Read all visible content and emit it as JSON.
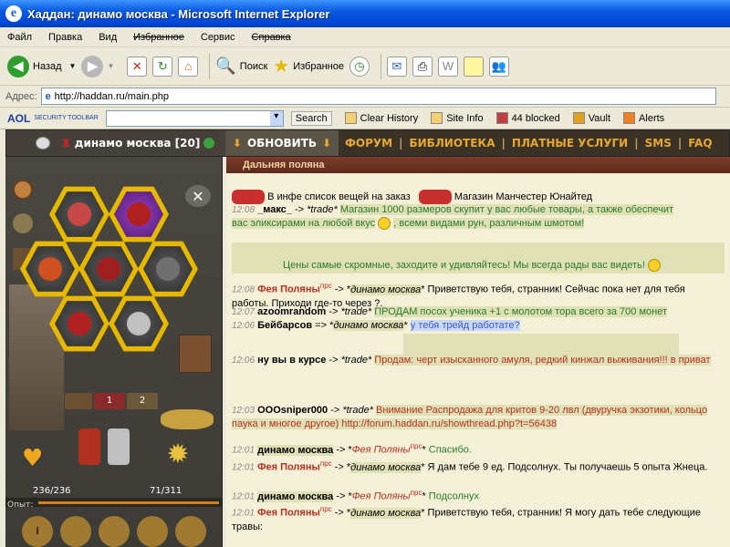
{
  "window": {
    "title": "Хаддан: динамо москва - Microsoft Internet Explorer"
  },
  "menu": [
    "Файл",
    "Правка",
    "Вид",
    "Избранное",
    "Сервис",
    "Справка"
  ],
  "toolbar": {
    "back": "Назад",
    "search": "Поиск",
    "favorites": "Избранное"
  },
  "address": {
    "label": "Адрес:",
    "url": "http://haddan.ru/main.php"
  },
  "aol": {
    "brand": "AOL",
    "security": "SECURITY TOOLBAR",
    "search_btn": "Search",
    "clear_history": "Clear History",
    "site_info": "Site Info",
    "blocked": "44 blocked",
    "vault": "Vault",
    "alerts": "Alerts"
  },
  "game": {
    "location": "динамо москва [20]",
    "refresh": "ОБНОВИТЬ",
    "links": [
      "ФОРУМ",
      "БИБЛИОТЕКА",
      "ПЛАТНЫЕ УСЛУГИ",
      "SMS",
      "FAQ"
    ],
    "hp": "236/236",
    "mana": "71/311",
    "exp_label": "Опыт:",
    "slot_tabs": [
      "1",
      "2"
    ]
  },
  "chat": {
    "room": "Дальняя поляна",
    "lines": [
      {
        "time": "",
        "nick": "",
        "text": "В инфе список вещей на заказ",
        "extra": "Магазин Манчестер Юнайтед"
      },
      {
        "time": "12:08",
        "nick": "_макс_",
        "to": "*trade*",
        "text": "Магазин 1000 размеров скупит у вас любые товары, а также обеспечит вас эликсирами на любой вкус",
        "text2": ", всеми видами рун, различным шмотом!",
        "text3": "Цены самые скромные, заходите и удивляйтесь! Мы всегда рады вас видеть!"
      },
      {
        "time": "12:08",
        "nick": "Фея Поляны",
        "sup": "прс",
        "to": "динамо москва",
        "text": "Приветствую тебя, странник! Сейчас пока нет для тебя работы. Приходи где-то через ?."
      },
      {
        "time": "12:07",
        "nick": "azoomrandom",
        "to": "*trade*",
        "text": "ПРОДАМ посох ученика +1 с молотом тора всего за 700 монет"
      },
      {
        "time": "12:06",
        "nick": "Бейбарсов",
        "to": "динамо москва",
        "text": "у тебя трейд работате?"
      },
      {
        "time": "12:06",
        "nick": "ну вы в курсе",
        "to": "*trade*",
        "text": "Продам: черт изысканного амуля, редкий кинжал выживания!!! в приват"
      },
      {
        "time": "12:03",
        "nick": "OOOsniper000",
        "to": "*trade*",
        "text": "Внимание Распродажа для критов 9-20 лвл (двуручка экзотики, кольцо паука и многое другое) http://forum.haddan.ru/showthread.php?t=56438"
      },
      {
        "time": "12:01",
        "nick": "динамо москва",
        "to": "Фея Поляны",
        "sup": "прс",
        "text": "Спасибо."
      },
      {
        "time": "12:01",
        "nick": "Фея Поляны",
        "sup": "прс",
        "to": "динамо москва",
        "text": "Я дам тебе 9 ед. Подсолнух. Ты получаешь 5 опыта Жнеца."
      },
      {
        "time": "12:01",
        "nick": "динамо москва",
        "to": "Фея Поляны",
        "sup": "прс",
        "text": "Подсолнух"
      },
      {
        "time": "12:01",
        "nick": "Фея Поляны",
        "sup": "прс",
        "to": "динамо москва",
        "text": "Приветствую тебя, странник! Я могу дать тебе следующие травы:"
      }
    ]
  }
}
